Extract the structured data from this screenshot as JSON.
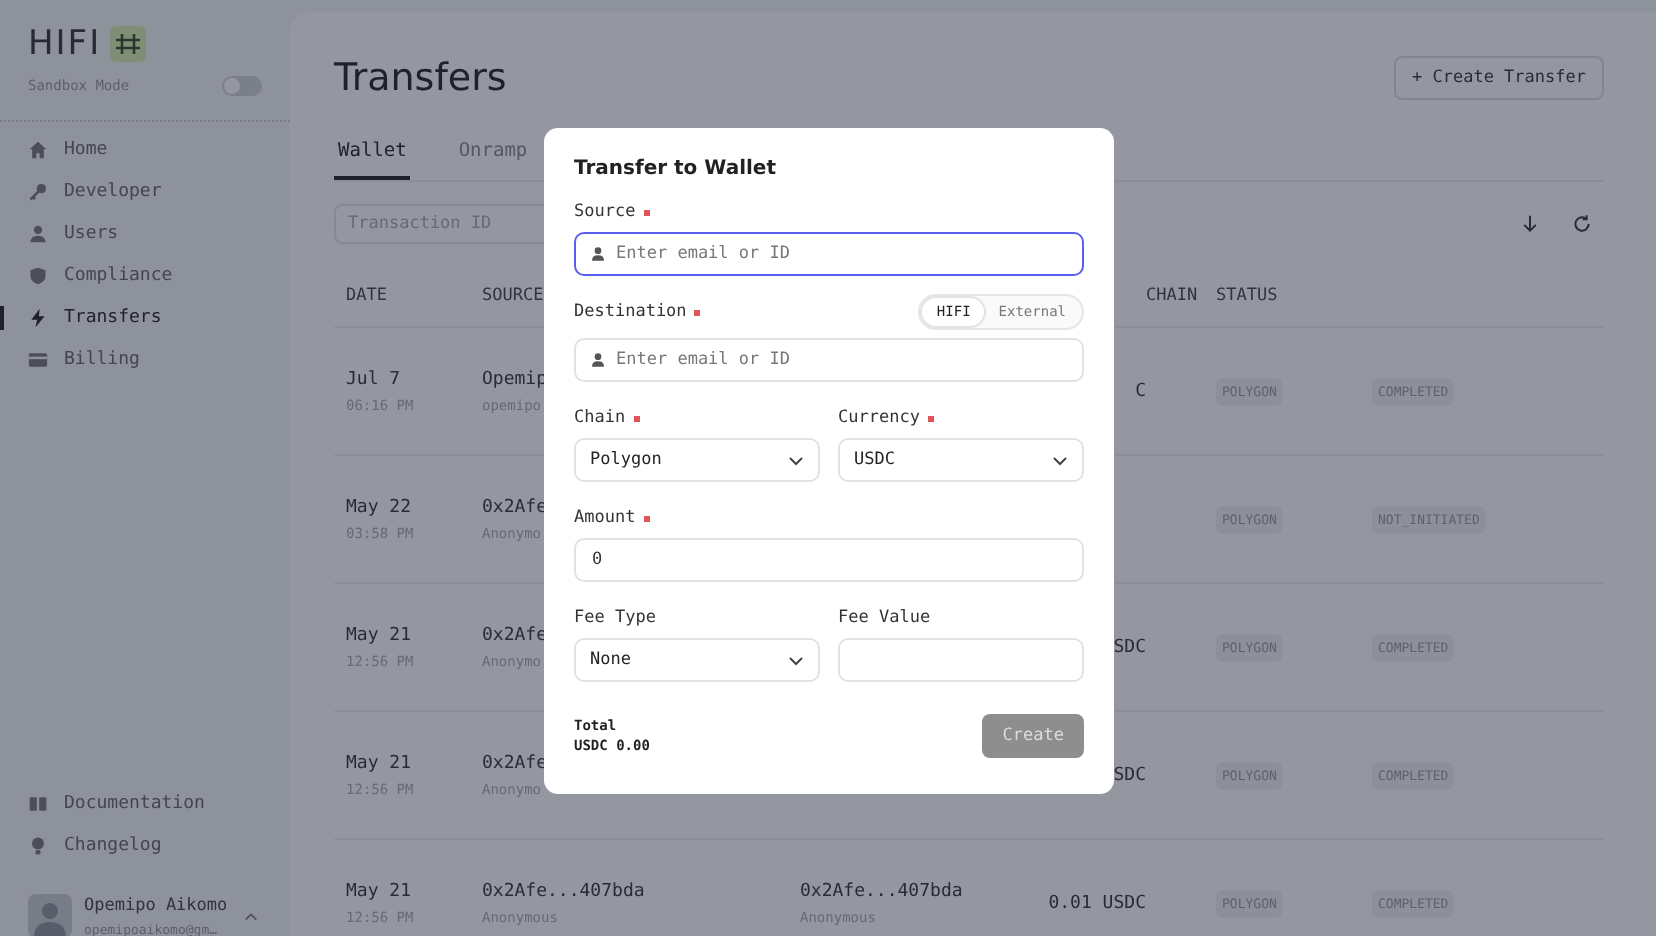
{
  "sidebar": {
    "logo": "HIFI",
    "sandbox": {
      "label": "Sandbox Mode",
      "on": false
    },
    "nav": [
      {
        "label": "Home",
        "selected": false
      },
      {
        "label": "Developer",
        "selected": false
      },
      {
        "label": "Users",
        "selected": false
      },
      {
        "label": "Compliance",
        "selected": false
      },
      {
        "label": "Transfers",
        "selected": true
      },
      {
        "label": "Billing",
        "selected": false
      }
    ],
    "footer_nav": [
      {
        "label": "Documentation"
      },
      {
        "label": "Changelog"
      }
    ],
    "user": {
      "name": "Opemipo Aikomo",
      "email": "opemipoaikomo@gm…"
    }
  },
  "main": {
    "title": "Transfers",
    "create_button": "+ Create Transfer",
    "tabs": [
      {
        "label": "Wallet",
        "selected": true
      },
      {
        "label": "Onramp",
        "selected": false
      }
    ],
    "search": {
      "placeholder": "Transaction ID"
    },
    "table": {
      "columns": [
        "DATE",
        "SOURCE",
        "",
        "",
        "CHAIN",
        "STATUS"
      ],
      "rows": [
        {
          "date": "Jul 7",
          "time": "06:16 PM",
          "source": "Opemip",
          "source_sub": "opemipo",
          "amount": "C",
          "chain": "POLYGON",
          "status": "COMPLETED"
        },
        {
          "date": "May 22",
          "time": "03:58 PM",
          "source": "0x2Afe",
          "source_sub": "Anonymo",
          "chain": "POLYGON",
          "status": "NOT_INITIATED"
        },
        {
          "date": "May 21",
          "time": "12:56 PM",
          "source": "0x2Afe",
          "source_sub": "Anonymo",
          "amount": "SDC",
          "chain": "POLYGON",
          "status": "COMPLETED"
        },
        {
          "date": "May 21",
          "time": "12:56 PM",
          "source": "0x2Afe",
          "source_sub": "Anonymo",
          "amount": "SDC",
          "chain": "POLYGON",
          "status": "COMPLETED"
        },
        {
          "date": "May 21",
          "time": "12:56 PM",
          "source": "0x2Afe...407bda",
          "source_sub": "Anonymous",
          "destination": "0x2Afe...407bda",
          "destination_sub": "Anonymous",
          "amount": "0.01 USDC",
          "chain": "POLYGON",
          "status": "COMPLETED"
        }
      ]
    }
  },
  "modal": {
    "title": "Transfer to Wallet",
    "source": {
      "label": "Source",
      "required": true,
      "placeholder": "Enter email or ID",
      "focused": true
    },
    "destination": {
      "label": "Destination",
      "required": true,
      "placeholder": "Enter email or ID",
      "focused": false,
      "options": [
        {
          "label": "HIFI",
          "selected": true
        },
        {
          "label": "External",
          "selected": false
        }
      ]
    },
    "chain": {
      "label": "Chain",
      "required": true,
      "value": "Polygon"
    },
    "currency": {
      "label": "Currency",
      "required": true,
      "value": "USDC"
    },
    "amount": {
      "label": "Amount",
      "required": true,
      "value": "0"
    },
    "fee_type": {
      "label": "Fee Type",
      "value": "None"
    },
    "fee_value": {
      "label": "Fee Value"
    },
    "total_label": "Total",
    "total_value": "USDC 0.00",
    "create_button": {
      "label": "Create",
      "disabled": true
    }
  }
}
